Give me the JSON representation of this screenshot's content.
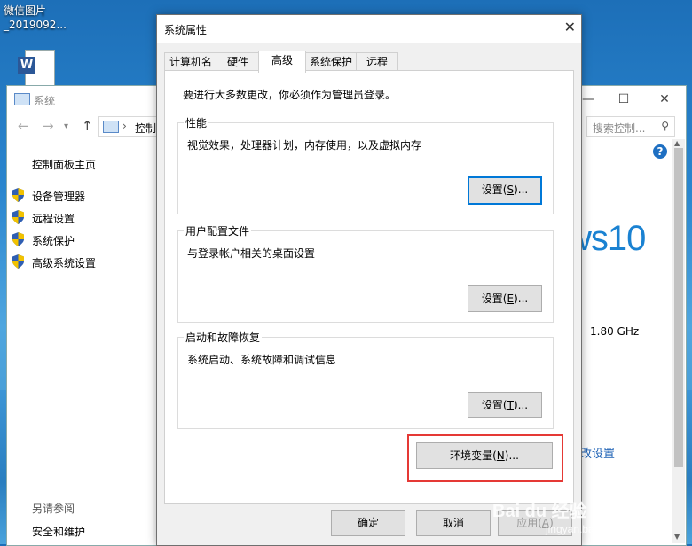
{
  "desktop": {
    "icon_label_line1": "微信图片",
    "icon_label_line2": "_2019092..."
  },
  "system_window": {
    "title": "系统",
    "minimize": "—",
    "maximize": "☐",
    "close": "✕",
    "breadcrumb": "控制",
    "search_placeholder": "搜索控制...",
    "control_panel_home": "控制面板主页",
    "nav_items": [
      {
        "label": "设备管理器"
      },
      {
        "label": "远程设置"
      },
      {
        "label": "系统保护"
      },
      {
        "label": "高级系统设置"
      }
    ],
    "see_also": "另请参阅",
    "security": "安全和维护",
    "windows_brand": "ws10",
    "cpu_speed": "1.80 GHz",
    "change_settings": "改设置"
  },
  "dialog": {
    "title": "系统属性",
    "tabs": [
      {
        "label": "计算机名"
      },
      {
        "label": "硬件"
      },
      {
        "label": "高级"
      },
      {
        "label": "系统保护"
      },
      {
        "label": "远程"
      }
    ],
    "active_tab": "高级",
    "admin_note": "要进行大多数更改，你必须作为管理员登录。",
    "performance": {
      "title": "性能",
      "desc": "视觉效果，处理器计划，内存使用，以及虚拟内存",
      "button_prefix": "设置(",
      "button_key": "S",
      "button_suffix": ")..."
    },
    "user_profiles": {
      "title": "用户配置文件",
      "desc": "与登录帐户相关的桌面设置",
      "button_prefix": "设置(",
      "button_key": "E",
      "button_suffix": ")..."
    },
    "startup": {
      "title": "启动和故障恢复",
      "desc": "系统启动、系统故障和调试信息",
      "button_prefix": "设置(",
      "button_key": "T",
      "button_suffix": ")..."
    },
    "env_button": {
      "prefix": "环境变量(",
      "key": "N",
      "suffix": ")..."
    },
    "ok": "确定",
    "cancel": "取消",
    "apply_prefix": "应用(",
    "apply_key": "A",
    "apply_suffix": ")"
  },
  "watermark": {
    "brand": "Bai du 经验",
    "url": "jingyan.baidu.com"
  },
  "colors": {
    "highlight": "#e53935",
    "accent": "#0078d7"
  }
}
